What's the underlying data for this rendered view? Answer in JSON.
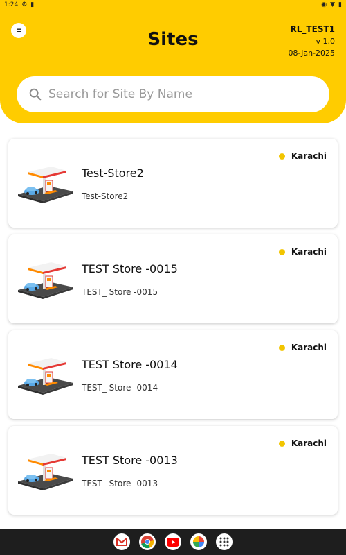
{
  "status_bar": {
    "time": "1:24"
  },
  "header": {
    "title": "Sites",
    "user": "RL_TEST1",
    "version": "v 1.0",
    "date": "08-Jan-2025",
    "menu_icon": "menu-icon"
  },
  "search": {
    "placeholder": "Search for Site By Name",
    "value": ""
  },
  "colors": {
    "brand_yellow": "#ffcc00",
    "city_dot": "#f2c500"
  },
  "sites": [
    {
      "name": "Test-Store2",
      "code": "Test-Store2",
      "city": "Karachi"
    },
    {
      "name": "TEST Store -0015",
      "code": "TEST_ Store -0015",
      "city": "Karachi"
    },
    {
      "name": "TEST Store -0014",
      "code": "TEST_ Store -0014",
      "city": "Karachi"
    },
    {
      "name": "TEST Store -0013",
      "code": "TEST_ Store -0013",
      "city": "Karachi"
    }
  ],
  "dock_apps": [
    "gmail-icon",
    "chrome-icon",
    "youtube-icon",
    "photos-icon",
    "app-drawer-icon"
  ]
}
